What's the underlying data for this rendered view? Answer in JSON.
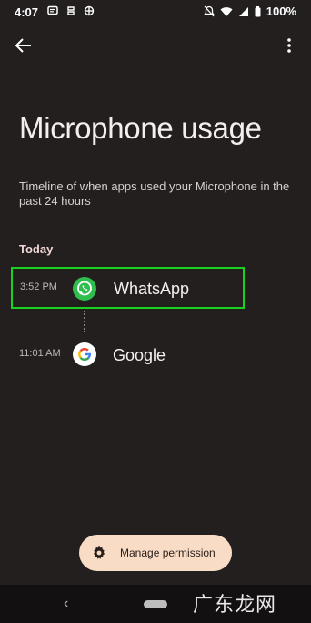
{
  "status_bar": {
    "time": "4:07",
    "battery": "100%"
  },
  "page": {
    "title": "Microphone usage",
    "subtitle": "Timeline of when apps used your Microphone in the past 24 hours",
    "section": "Today"
  },
  "timeline": [
    {
      "time": "3:52 PM",
      "app": "WhatsApp",
      "icon": "whatsapp-icon",
      "highlight_color": "#19d11f"
    },
    {
      "time": "11:01 AM",
      "app": "Google",
      "icon": "google-icon"
    }
  ],
  "manage_button": {
    "label": "Manage permission",
    "icon": "gear-icon",
    "color": "#f8dcc5"
  },
  "watermark": "广东龙网",
  "colors": {
    "background": "#231f1f",
    "nav_bar": "#121010"
  }
}
